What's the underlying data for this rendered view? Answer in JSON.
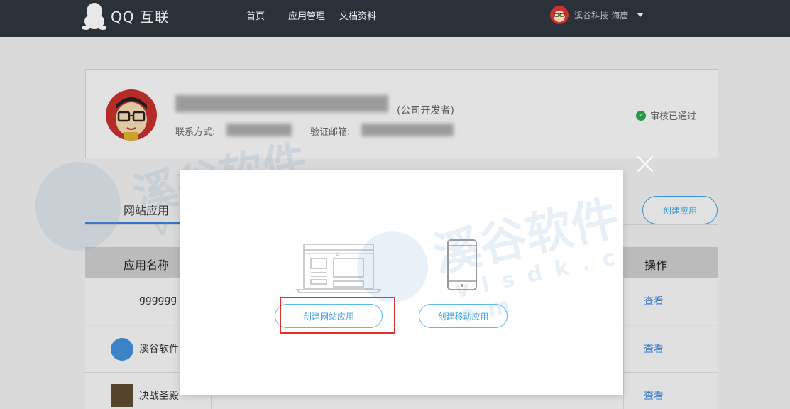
{
  "header": {
    "logo_text": "QQ 互联",
    "nav": [
      "首页",
      "应用管理",
      "文档资料"
    ],
    "user_name": "溪谷科技-海唐"
  },
  "profile": {
    "company_tag": "(公司开发者)",
    "contact_label": "联系方式:",
    "email_label": "验证邮箱:",
    "status": "审核已通过"
  },
  "tabs": {
    "site_apps": "网站应用",
    "create_button": "创建应用"
  },
  "table": {
    "headers": {
      "name": "应用名称",
      "operation": "操作"
    },
    "rows": [
      {
        "name": "gggggg",
        "action": "查看"
      },
      {
        "name": "溪谷软件",
        "action": "查看"
      },
      {
        "name": "决战圣殿",
        "action": "查看"
      }
    ]
  },
  "modal": {
    "create_web_app": "创建网站应用",
    "create_mobile_app": "创建移动应用"
  },
  "watermark": {
    "text_cn": "溪谷软件",
    "text_en": "v l s d k . c o m"
  },
  "colors": {
    "accent": "#3aa3e3",
    "topbar": "#2b3138",
    "highlight": "#e0302c",
    "verified": "#2da44e",
    "link": "#2f7fd8"
  }
}
